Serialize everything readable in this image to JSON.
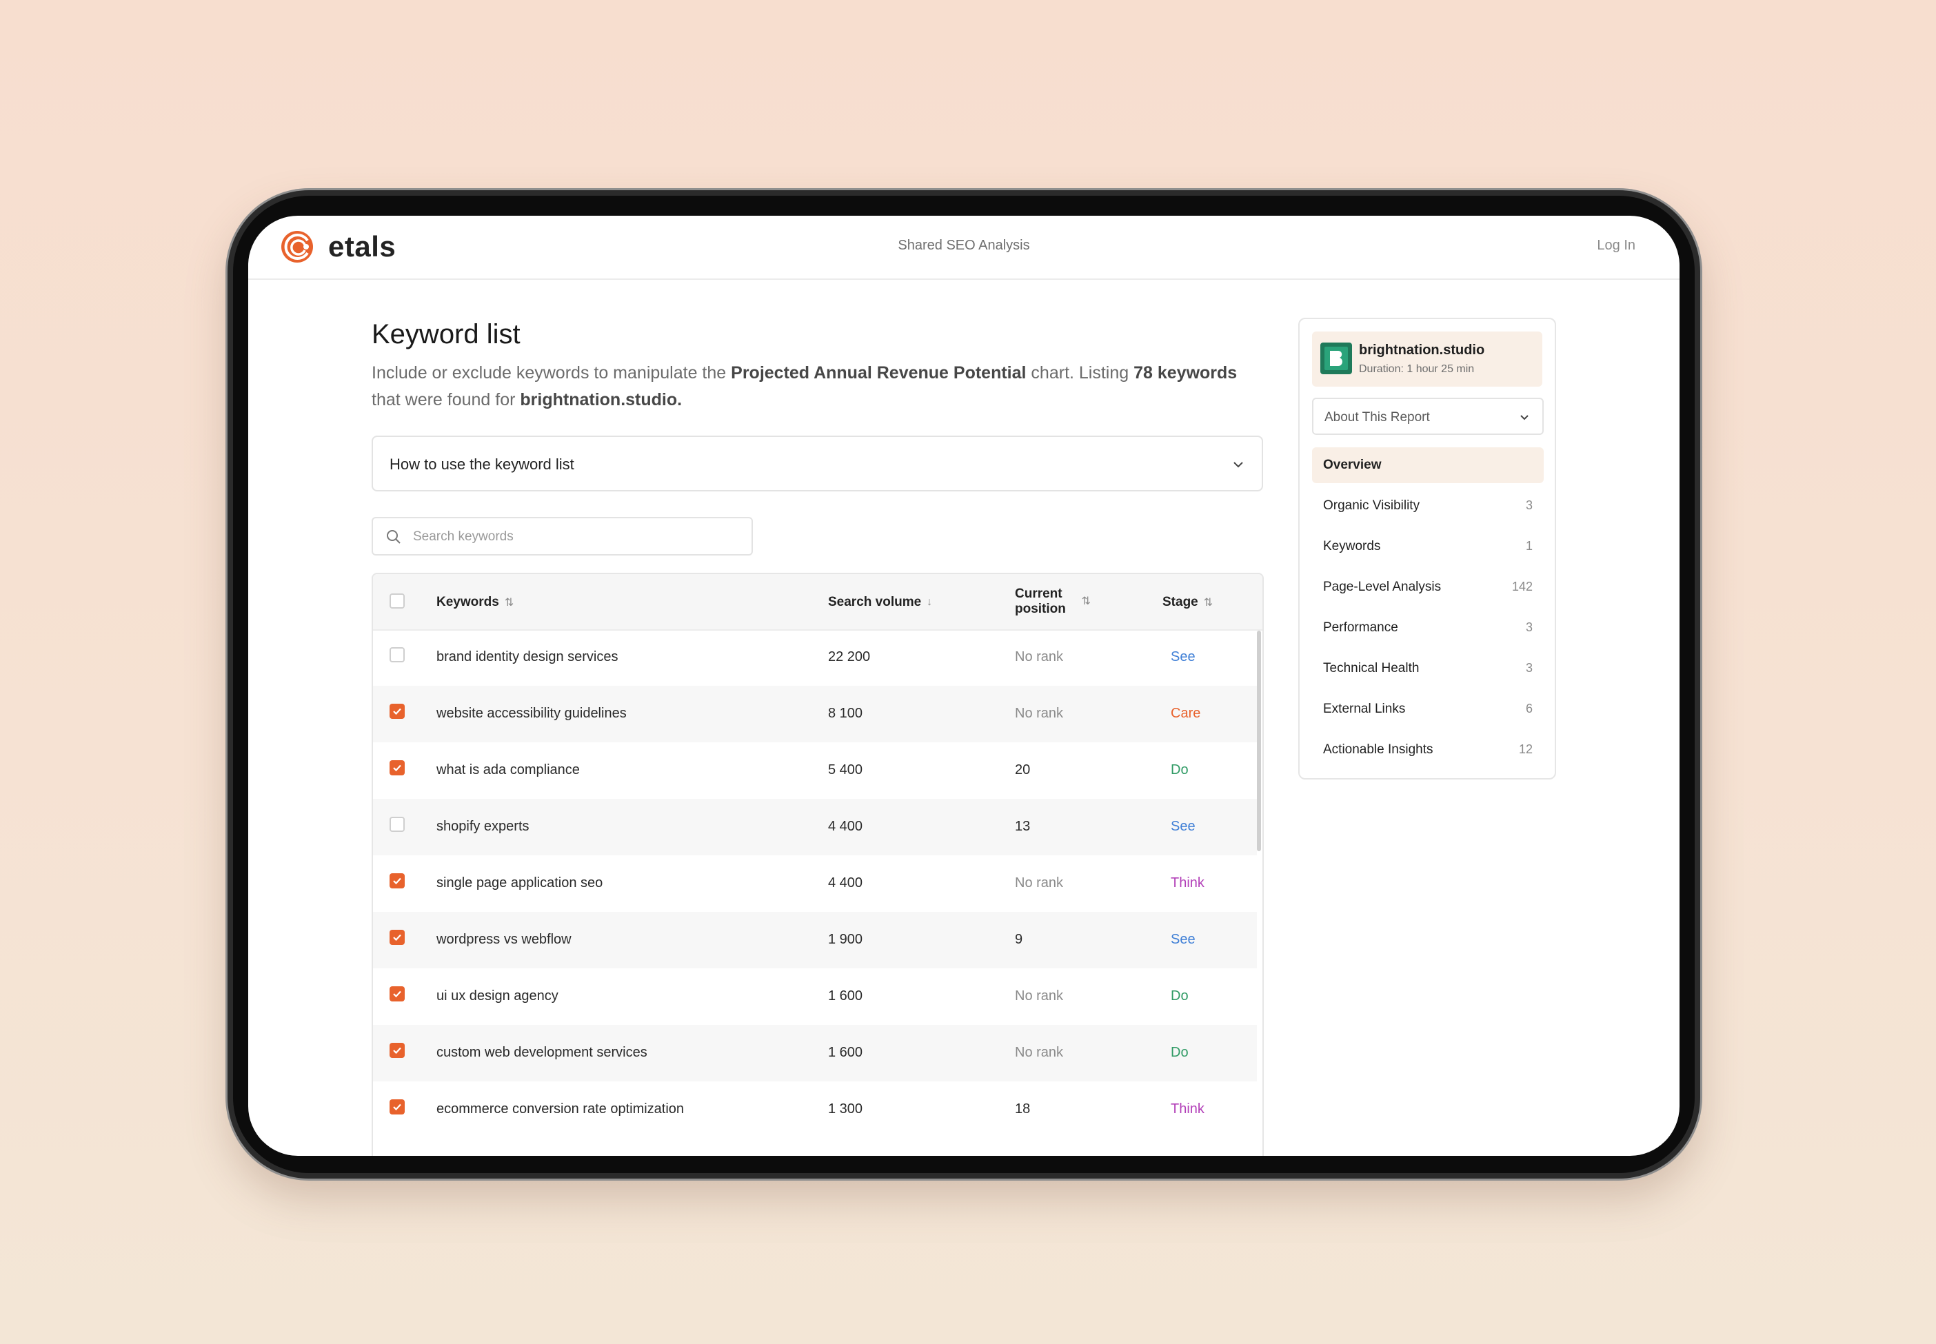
{
  "header": {
    "brand": "etals",
    "title": "Shared SEO Analysis",
    "login": "Log In"
  },
  "main": {
    "title": "Keyword list",
    "desc": {
      "p1": "Include or exclude keywords to manipulate the ",
      "b1": "Projected Annual Revenue Potential",
      "p2": " chart. Listing ",
      "b2": "78 keywords",
      "p3": " that were found for ",
      "b3": "brightnation.studio."
    },
    "howto": "How to use the keyword list",
    "search": {
      "placeholder": "Search keywords",
      "value": ""
    }
  },
  "table": {
    "columns": {
      "keywords": "Keywords",
      "volume": "Search volume",
      "position": "Current position",
      "stage": "Stage"
    },
    "rows": [
      {
        "checked": false,
        "keyword": "brand identity design services",
        "volume": "22 200",
        "position": "No rank",
        "stage": "See"
      },
      {
        "checked": true,
        "keyword": "website accessibility guidelines",
        "volume": "8 100",
        "position": "No rank",
        "stage": "Care"
      },
      {
        "checked": true,
        "keyword": "what is ada compliance",
        "volume": "5 400",
        "position": "20",
        "stage": "Do"
      },
      {
        "checked": false,
        "keyword": "shopify experts",
        "volume": "4 400",
        "position": "13",
        "stage": "See"
      },
      {
        "checked": true,
        "keyword": "single page application seo",
        "volume": "4 400",
        "position": "No rank",
        "stage": "Think"
      },
      {
        "checked": true,
        "keyword": "wordpress vs webflow",
        "volume": "1 900",
        "position": "9",
        "stage": "See"
      },
      {
        "checked": true,
        "keyword": "ui ux design agency",
        "volume": "1 600",
        "position": "No rank",
        "stage": "Do"
      },
      {
        "checked": true,
        "keyword": "custom web development services",
        "volume": "1 600",
        "position": "No rank",
        "stage": "Do"
      },
      {
        "checked": true,
        "keyword": "ecommerce conversion rate optimization",
        "volume": "1 300",
        "position": "18",
        "stage": "Think"
      }
    ]
  },
  "sidebar": {
    "site": "brightnation.studio",
    "duration": "Duration: 1 hour 25 min",
    "about": "About This Report",
    "nav": [
      {
        "label": "Overview",
        "count": "",
        "active": true
      },
      {
        "label": "Organic Visibility",
        "count": "3",
        "active": false
      },
      {
        "label": "Keywords",
        "count": "1",
        "active": false
      },
      {
        "label": "Page-Level Analysis",
        "count": "142",
        "active": false
      },
      {
        "label": "Performance",
        "count": "3",
        "active": false
      },
      {
        "label": "Technical Health",
        "count": "3",
        "active": false
      },
      {
        "label": "External Links",
        "count": "6",
        "active": false
      },
      {
        "label": "Actionable Insights",
        "count": "12",
        "active": false
      }
    ]
  },
  "colors": {
    "accent": "#e8622c",
    "see": "#3f7fd6",
    "care": "#e8622c",
    "do": "#2f9a64",
    "think": "#b23fb8"
  }
}
